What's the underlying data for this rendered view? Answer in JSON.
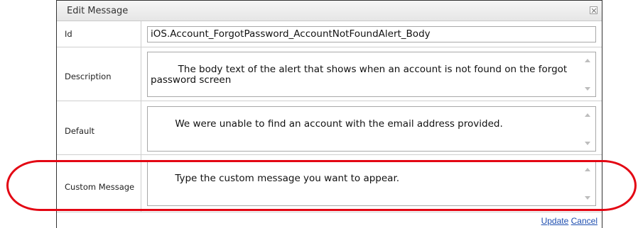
{
  "dialog": {
    "title": "Edit Message",
    "close_icon": "close-x-icon"
  },
  "fields": {
    "id": {
      "label": "Id",
      "value": "iOS.Account_ForgotPassword_AccountNotFoundAlert_Body"
    },
    "description": {
      "label": "Description",
      "value": " The body text of the alert that shows when an account is not found on the forgot password screen"
    },
    "default": {
      "label": "Default",
      "value": "We were unable to find an account with the email address provided."
    },
    "custom_message": {
      "label": "Custom Message",
      "value": "Type the custom message you want to appear."
    }
  },
  "footer": {
    "update_label": "Update",
    "cancel_label": "Cancel"
  },
  "colors": {
    "highlight": "#e30613",
    "link": "#1f4fb0",
    "border": "#a8a8a8"
  }
}
